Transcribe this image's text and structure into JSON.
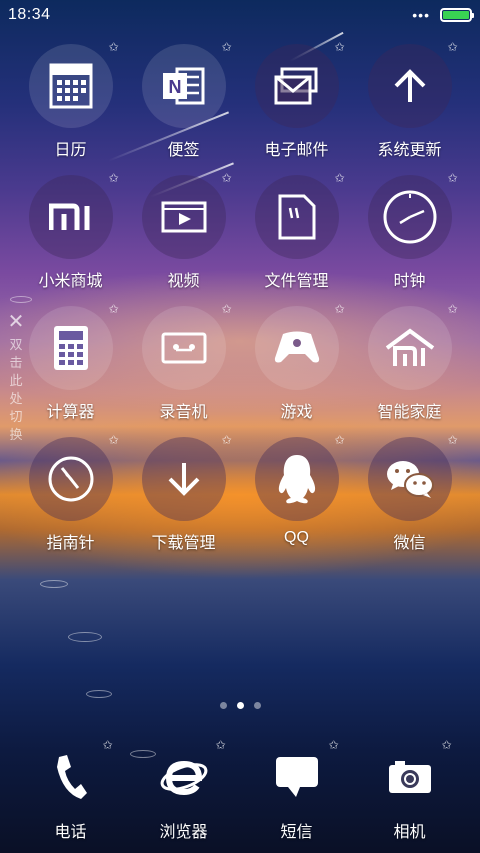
{
  "status_bar": {
    "time": "18:34",
    "more_glyph": "•••",
    "battery_color": "#39d353",
    "battery_level": 1.0
  },
  "apps": [
    [
      {
        "label": "日历",
        "icon": "calendar-icon"
      },
      {
        "label": "便签",
        "icon": "notes-icon"
      },
      {
        "label": "电子邮件",
        "icon": "mail-icon"
      },
      {
        "label": "系统更新",
        "icon": "update-arrow-icon"
      }
    ],
    [
      {
        "label": "小米商城",
        "icon": "mi-store-icon"
      },
      {
        "label": "视频",
        "icon": "video-icon"
      },
      {
        "label": "文件管理",
        "icon": "file-icon"
      },
      {
        "label": "时钟",
        "icon": "clock-icon"
      }
    ],
    [
      {
        "label": "计算器",
        "icon": "calculator-icon"
      },
      {
        "label": "录音机",
        "icon": "recorder-icon"
      },
      {
        "label": "游戏",
        "icon": "gamepad-icon"
      },
      {
        "label": "智能家庭",
        "icon": "smart-home-icon"
      }
    ],
    [
      {
        "label": "指南针",
        "icon": "compass-icon"
      },
      {
        "label": "下载管理",
        "icon": "download-icon"
      },
      {
        "label": "QQ",
        "icon": "qq-penguin-icon"
      },
      {
        "label": "微信",
        "icon": "wechat-icon"
      }
    ]
  ],
  "side_hint": {
    "close_glyph": "✕",
    "text": "双击此处切换"
  },
  "pager": {
    "count": 3,
    "active": 1
  },
  "dock": [
    {
      "label": "电话",
      "icon": "phone-icon"
    },
    {
      "label": "浏览器",
      "icon": "browser-icon"
    },
    {
      "label": "短信",
      "icon": "message-icon"
    },
    {
      "label": "相机",
      "icon": "camera-icon"
    }
  ],
  "theme": {
    "star_glyph": "✩",
    "icon_color": "#ffffff"
  }
}
